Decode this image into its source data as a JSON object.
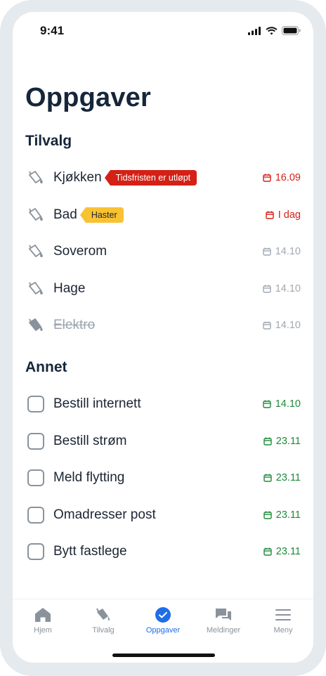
{
  "status": {
    "time": "9:41"
  },
  "page": {
    "title": "Oppgaver"
  },
  "sections": {
    "tilvalg": "Tilvalg",
    "annet": "Annet"
  },
  "tilvalg_items": [
    {
      "label": "Kjøkken",
      "badge": "Tidsfristen er utløpt",
      "badge_color": "#d42015",
      "date": "16.09",
      "date_color": "#d42015"
    },
    {
      "label": "Bad",
      "badge": "Haster",
      "badge_color": "#f9c233",
      "date": "I dag",
      "date_color": "#d42015"
    },
    {
      "label": "Soverom",
      "date": "14.10",
      "date_color": "#a2a9b1"
    },
    {
      "label": "Hage",
      "date": "14.10",
      "date_color": "#a2a9b1"
    },
    {
      "label": "Elektro",
      "completed": true,
      "date": "14.10",
      "date_color": "#a2a9b1"
    }
  ],
  "annet_items": [
    {
      "label": "Bestill internett",
      "date": "14.10",
      "date_color": "#1e8a3a"
    },
    {
      "label": "Bestill strøm",
      "date": "23.11",
      "date_color": "#1e8a3a"
    },
    {
      "label": "Meld flytting",
      "date": "23.11",
      "date_color": "#1e8a3a"
    },
    {
      "label": "Omadresser post",
      "date": "23.11",
      "date_color": "#1e8a3a"
    },
    {
      "label": "Bytt fastlege",
      "date": "23.11",
      "date_color": "#1e8a3a"
    }
  ],
  "tabs": [
    {
      "label": "Hjem",
      "icon": "home-icon"
    },
    {
      "label": "Tilvalg",
      "icon": "paint-bucket-icon"
    },
    {
      "label": "Oppgaver",
      "icon": "check-circle-icon",
      "active": true
    },
    {
      "label": "Meldinger",
      "icon": "chat-icon"
    },
    {
      "label": "Meny",
      "icon": "menu-icon"
    }
  ],
  "colors": {
    "accent": "#1f6ee6",
    "overdue": "#d42015",
    "urgent": "#f9c233",
    "ok": "#1e8a3a"
  }
}
